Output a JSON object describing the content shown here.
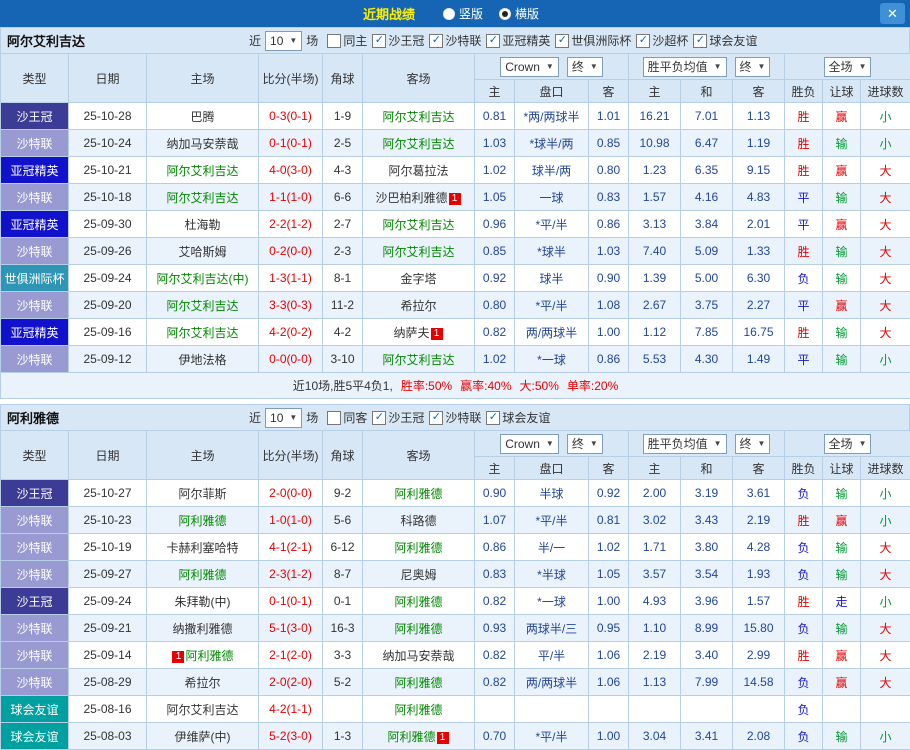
{
  "topbar": {
    "title": "近期战绩",
    "vertical_label": "竖版",
    "vertical_selected": false,
    "horizontal_label": "横版",
    "horizontal_selected": true
  },
  "icons": {
    "chevron_down": "▼",
    "check": "✓",
    "close": "✕"
  },
  "labels": {
    "near": "近",
    "games": "场"
  },
  "controls": {
    "company": "Crown",
    "final": "终",
    "euro": "胜平负均值",
    "euro_final": "终",
    "scope": "全场"
  },
  "columns": {
    "type": "类型",
    "date": "日期",
    "home": "主场",
    "score": "比分(半场)",
    "corner": "角球",
    "away": "客场",
    "ah_home": "主",
    "ah_line": "盘口",
    "ah_away": "客",
    "eu_home": "主",
    "eu_draw": "和",
    "eu_away": "客",
    "result": "胜负",
    "handicap": "让球",
    "goals": "进球数"
  },
  "colors": {
    "topbar_bg": "#1565b4",
    "title_yellow": "#ffee00",
    "header_bg": "#d8e7f6",
    "row_alt_bg": "#eaf2fb",
    "border": "#b6cfe7",
    "score_red": "#e60000",
    "odds_blue": "#21469b",
    "team_green": "#008800",
    "type_map": {
      "沙王冠": "#3c3c96",
      "沙特联": "#9a9ad2",
      "亚冠精英": "#1212cc",
      "世俱洲际杯": "#2e96b4",
      "球会友谊": "#00a0a0"
    },
    "result_map": {
      "red": "#e60000",
      "green": "#009933",
      "blue": "#1414d0",
      "dark": "#333333"
    }
  },
  "sections": [
    {
      "team": "阿尔艾利吉达",
      "count": "10",
      "filters": [
        {
          "label": "同主",
          "checked": false
        },
        {
          "label": "沙王冠",
          "checked": true
        },
        {
          "label": "沙特联",
          "checked": true
        },
        {
          "label": "亚冠精英",
          "checked": true
        },
        {
          "label": "世俱洲际杯",
          "checked": true
        },
        {
          "label": "沙超杯",
          "checked": true
        },
        {
          "label": "球会友谊",
          "checked": true
        }
      ],
      "rows": [
        {
          "type": "沙王冠",
          "date": "25-10-28",
          "home": {
            "name": "巴腾"
          },
          "score": "0-3(0-1)",
          "corner": "1-9",
          "away": {
            "name": "阿尔艾利吉达",
            "self": true
          },
          "ah": [
            "0.81",
            "*两/两球半",
            "1.01"
          ],
          "eu": [
            "16.21",
            "7.01",
            "1.13"
          ],
          "res": [
            [
              "胜",
              "red"
            ],
            [
              "赢",
              "red"
            ],
            [
              "小",
              "green"
            ]
          ]
        },
        {
          "type": "沙特联",
          "date": "25-10-24",
          "home": {
            "name": "纳加马安萘哉"
          },
          "score": "0-1(0-1)",
          "corner": "2-5",
          "away": {
            "name": "阿尔艾利吉达",
            "self": true
          },
          "ah": [
            "1.03",
            "*球半/两",
            "0.85"
          ],
          "eu": [
            "10.98",
            "6.47",
            "1.19"
          ],
          "res": [
            [
              "胜",
              "red"
            ],
            [
              "输",
              "green"
            ],
            [
              "小",
              "green"
            ]
          ]
        },
        {
          "type": "亚冠精英",
          "date": "25-10-21",
          "home": {
            "name": "阿尔艾利吉达",
            "self": true
          },
          "score": "4-0(3-0)",
          "corner": "4-3",
          "away": {
            "name": "阿尔葛拉法"
          },
          "ah": [
            "1.02",
            "球半/两",
            "0.80"
          ],
          "eu": [
            "1.23",
            "6.35",
            "9.15"
          ],
          "res": [
            [
              "胜",
              "red"
            ],
            [
              "赢",
              "red"
            ],
            [
              "大",
              "red"
            ]
          ]
        },
        {
          "type": "沙特联",
          "date": "25-10-18",
          "home": {
            "name": "阿尔艾利吉达",
            "self": true
          },
          "score": "1-1(1-0)",
          "corner": "6-6",
          "away": {
            "name": "沙巴柏利雅德",
            "badge": "1"
          },
          "ah": [
            "1.05",
            "一球",
            "0.83"
          ],
          "eu": [
            "1.57",
            "4.16",
            "4.83"
          ],
          "res": [
            [
              "平",
              "blue"
            ],
            [
              "输",
              "green"
            ],
            [
              "大",
              "red"
            ]
          ]
        },
        {
          "type": "亚冠精英",
          "date": "25-09-30",
          "home": {
            "name": "杜海勒"
          },
          "score": "2-2(1-2)",
          "corner": "2-7",
          "away": {
            "name": "阿尔艾利吉达",
            "self": true
          },
          "ah": [
            "0.96",
            "*平/半",
            "0.86"
          ],
          "eu": [
            "3.13",
            "3.84",
            "2.01"
          ],
          "res": [
            [
              "平",
              "blue"
            ],
            [
              "赢",
              "red"
            ],
            [
              "大",
              "red"
            ]
          ]
        },
        {
          "type": "沙特联",
          "date": "25-09-26",
          "home": {
            "name": "艾哈斯姆"
          },
          "score": "0-2(0-0)",
          "corner": "2-3",
          "away": {
            "name": "阿尔艾利吉达",
            "self": true
          },
          "ah": [
            "0.85",
            "*球半",
            "1.03"
          ],
          "eu": [
            "7.40",
            "5.09",
            "1.33"
          ],
          "res": [
            [
              "胜",
              "red"
            ],
            [
              "输",
              "green"
            ],
            [
              "大",
              "red"
            ]
          ]
        },
        {
          "type": "世俱洲际杯",
          "date": "25-09-24",
          "home": {
            "name": "阿尔艾利吉达(中)",
            "self": true
          },
          "score": "1-3(1-1)",
          "corner": "8-1",
          "away": {
            "name": "金字塔"
          },
          "ah": [
            "0.92",
            "球半",
            "0.90"
          ],
          "eu": [
            "1.39",
            "5.00",
            "6.30"
          ],
          "res": [
            [
              "负",
              "blue"
            ],
            [
              "输",
              "green"
            ],
            [
              "大",
              "red"
            ]
          ]
        },
        {
          "type": "沙特联",
          "date": "25-09-20",
          "home": {
            "name": "阿尔艾利吉达",
            "self": true
          },
          "score": "3-3(0-3)",
          "corner": "11-2",
          "away": {
            "name": "希拉尔"
          },
          "ah": [
            "0.80",
            "*平/半",
            "1.08"
          ],
          "eu": [
            "2.67",
            "3.75",
            "2.27"
          ],
          "res": [
            [
              "平",
              "blue"
            ],
            [
              "赢",
              "red"
            ],
            [
              "大",
              "red"
            ]
          ]
        },
        {
          "type": "亚冠精英",
          "date": "25-09-16",
          "home": {
            "name": "阿尔艾利吉达",
            "self": true
          },
          "score": "4-2(0-2)",
          "corner": "4-2",
          "away": {
            "name": "纳萨夫",
            "badge": "1"
          },
          "ah": [
            "0.82",
            "两/两球半",
            "1.00"
          ],
          "eu": [
            "1.12",
            "7.85",
            "16.75"
          ],
          "res": [
            [
              "胜",
              "red"
            ],
            [
              "输",
              "green"
            ],
            [
              "大",
              "red"
            ]
          ]
        },
        {
          "type": "沙特联",
          "date": "25-09-12",
          "home": {
            "name": "伊地法格"
          },
          "score": "0-0(0-0)",
          "corner": "3-10",
          "away": {
            "name": "阿尔艾利吉达",
            "self": true
          },
          "ah": [
            "1.02",
            "*一球",
            "0.86"
          ],
          "eu": [
            "5.53",
            "4.30",
            "1.49"
          ],
          "res": [
            [
              "平",
              "blue"
            ],
            [
              "输",
              "green"
            ],
            [
              "小",
              "green"
            ]
          ]
        }
      ],
      "summary": [
        [
          "近10场,胜5平4负1,",
          "dark"
        ],
        [
          "胜率:50%",
          "red"
        ],
        [
          "赢率:40%",
          "red"
        ],
        [
          "大:50%",
          "red"
        ],
        [
          "单率:20%",
          "red"
        ]
      ]
    },
    {
      "team": "阿利雅德",
      "count": "10",
      "filters": [
        {
          "label": "同客",
          "checked": false
        },
        {
          "label": "沙王冠",
          "checked": true
        },
        {
          "label": "沙特联",
          "checked": true
        },
        {
          "label": "球会友谊",
          "checked": true
        }
      ],
      "rows": [
        {
          "type": "沙王冠",
          "date": "25-10-27",
          "home": {
            "name": "阿尔菲斯"
          },
          "score": "2-0(0-0)",
          "corner": "9-2",
          "away": {
            "name": "阿利雅德",
            "self": true
          },
          "ah": [
            "0.90",
            "半球",
            "0.92"
          ],
          "eu": [
            "2.00",
            "3.19",
            "3.61"
          ],
          "res": [
            [
              "负",
              "blue"
            ],
            [
              "输",
              "green"
            ],
            [
              "小",
              "green"
            ]
          ]
        },
        {
          "type": "沙特联",
          "date": "25-10-23",
          "home": {
            "name": "阿利雅德",
            "self": true
          },
          "score": "1-0(1-0)",
          "corner": "5-6",
          "away": {
            "name": "科路德"
          },
          "ah": [
            "1.07",
            "*平/半",
            "0.81"
          ],
          "eu": [
            "3.02",
            "3.43",
            "2.19"
          ],
          "res": [
            [
              "胜",
              "red"
            ],
            [
              "赢",
              "red"
            ],
            [
              "小",
              "green"
            ]
          ]
        },
        {
          "type": "沙特联",
          "date": "25-10-19",
          "home": {
            "name": "卡赫利塞哈特"
          },
          "score": "4-1(2-1)",
          "corner": "6-12",
          "away": {
            "name": "阿利雅德",
            "self": true
          },
          "ah": [
            "0.86",
            "半/一",
            "1.02"
          ],
          "eu": [
            "1.71",
            "3.80",
            "4.28"
          ],
          "res": [
            [
              "负",
              "blue"
            ],
            [
              "输",
              "green"
            ],
            [
              "大",
              "red"
            ]
          ]
        },
        {
          "type": "沙特联",
          "date": "25-09-27",
          "home": {
            "name": "阿利雅德",
            "self": true
          },
          "score": "2-3(1-2)",
          "corner": "8-7",
          "away": {
            "name": "尼奥姆"
          },
          "ah": [
            "0.83",
            "*半球",
            "1.05"
          ],
          "eu": [
            "3.57",
            "3.54",
            "1.93"
          ],
          "res": [
            [
              "负",
              "blue"
            ],
            [
              "输",
              "green"
            ],
            [
              "大",
              "red"
            ]
          ]
        },
        {
          "type": "沙王冠",
          "date": "25-09-24",
          "home": {
            "name": "朱拜勒(中)"
          },
          "score": "0-1(0-1)",
          "corner": "0-1",
          "away": {
            "name": "阿利雅德",
            "self": true
          },
          "ah": [
            "0.82",
            "*一球",
            "1.00"
          ],
          "eu": [
            "4.93",
            "3.96",
            "1.57"
          ],
          "res": [
            [
              "胜",
              "red"
            ],
            [
              "走",
              "blue"
            ],
            [
              "小",
              "green"
            ]
          ]
        },
        {
          "type": "沙特联",
          "date": "25-09-21",
          "home": {
            "name": "纳撒利雅德"
          },
          "score": "5-1(3-0)",
          "corner": "16-3",
          "away": {
            "name": "阿利雅德",
            "self": true
          },
          "ah": [
            "0.93",
            "两球半/三",
            "0.95"
          ],
          "eu": [
            "1.10",
            "8.99",
            "15.80"
          ],
          "res": [
            [
              "负",
              "blue"
            ],
            [
              "输",
              "green"
            ],
            [
              "大",
              "red"
            ]
          ]
        },
        {
          "type": "沙特联",
          "date": "25-09-14",
          "home": {
            "name": "阿利雅德",
            "self": true,
            "badge_pre": "1"
          },
          "score": "2-1(2-0)",
          "corner": "3-3",
          "away": {
            "name": "纳加马安萘哉"
          },
          "ah": [
            "0.82",
            "平/半",
            "1.06"
          ],
          "eu": [
            "2.19",
            "3.40",
            "2.99"
          ],
          "res": [
            [
              "胜",
              "red"
            ],
            [
              "赢",
              "red"
            ],
            [
              "大",
              "red"
            ]
          ]
        },
        {
          "type": "沙特联",
          "date": "25-08-29",
          "home": {
            "name": "希拉尔"
          },
          "score": "2-0(2-0)",
          "corner": "5-2",
          "away": {
            "name": "阿利雅德",
            "self": true
          },
          "ah": [
            "0.82",
            "两/两球半",
            "1.06"
          ],
          "eu": [
            "1.13",
            "7.99",
            "14.58"
          ],
          "res": [
            [
              "负",
              "blue"
            ],
            [
              "赢",
              "red"
            ],
            [
              "大",
              "red"
            ]
          ]
        },
        {
          "type": "球会友谊",
          "date": "25-08-16",
          "home": {
            "name": "阿尔艾利吉达"
          },
          "score": "4-2(1-1)",
          "corner": "",
          "away": {
            "name": "阿利雅德",
            "self": true
          },
          "ah": [
            "",
            "",
            ""
          ],
          "eu": [
            "",
            "",
            ""
          ],
          "res": [
            [
              "负",
              "blue"
            ],
            [
              "",
              ""
            ],
            [
              "",
              ""
            ]
          ]
        },
        {
          "type": "球会友谊",
          "date": "25-08-03",
          "home": {
            "name": "伊维萨(中)"
          },
          "score": "5-2(3-0)",
          "corner": "1-3",
          "away": {
            "name": "阿利雅德",
            "self": true,
            "badge": "1"
          },
          "ah": [
            "0.70",
            "*平/半",
            "1.00"
          ],
          "eu": [
            "3.04",
            "3.41",
            "2.08"
          ],
          "res": [
            [
              "负",
              "blue"
            ],
            [
              "输",
              "green"
            ],
            [
              "小",
              "green"
            ]
          ]
        }
      ],
      "summary": null
    }
  ]
}
